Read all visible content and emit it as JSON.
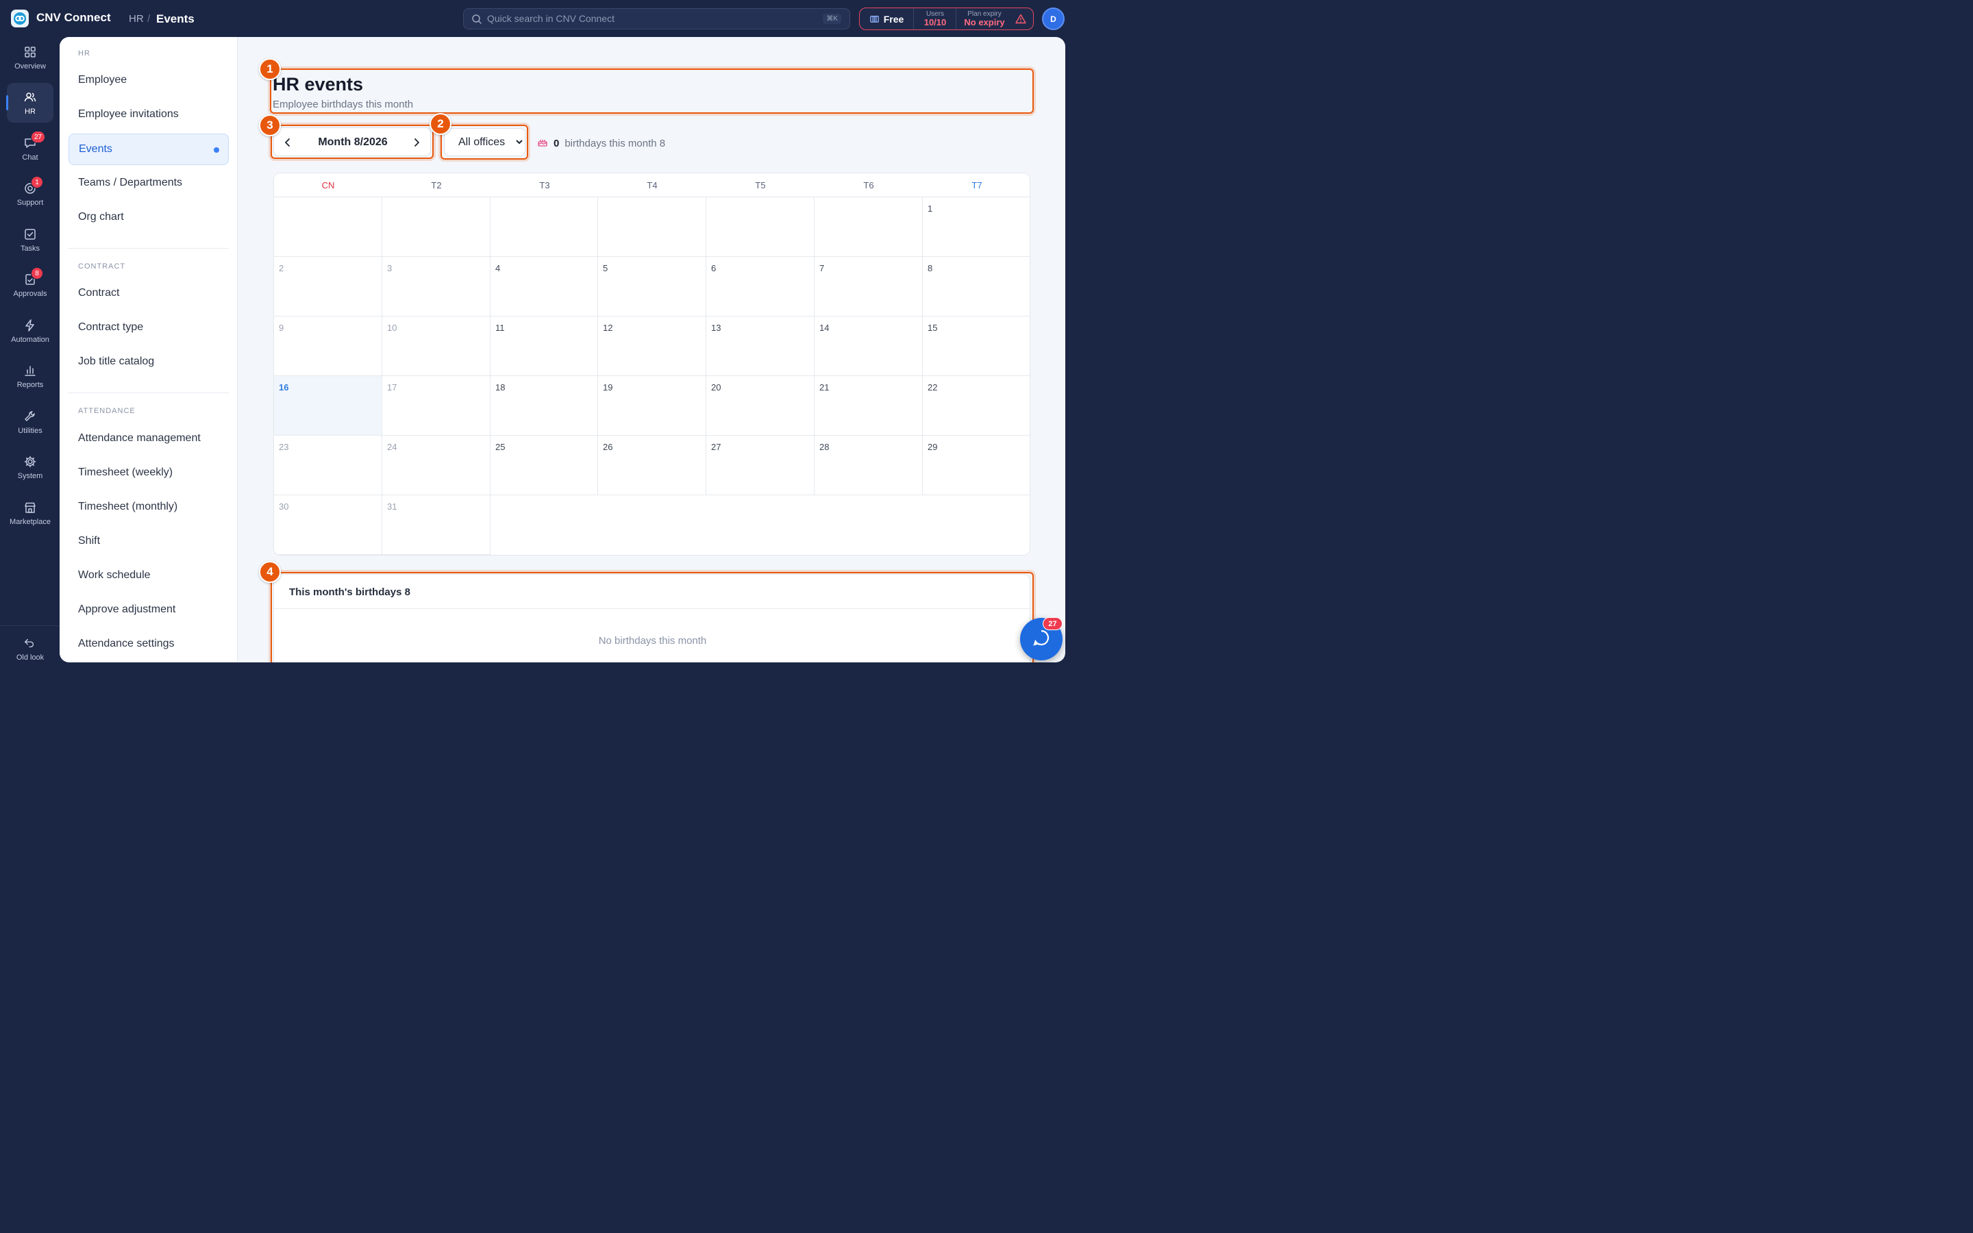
{
  "app": {
    "name": "CNV Connect",
    "breadcrumb_root": "HR",
    "breadcrumb_sep": "/",
    "breadcrumb_current": "Events"
  },
  "search": {
    "placeholder": "Quick search in CNV Connect",
    "shortcut": "⌘K"
  },
  "plan": {
    "name": "Free",
    "users_label": "Users",
    "users_value": "10/10",
    "expiry_label": "Plan expiry",
    "expiry_value": "No expiry",
    "accent": "#e5485f"
  },
  "user": {
    "initial": "D"
  },
  "rail": [
    {
      "label": "Overview",
      "icon": "grid-icon",
      "badge": ""
    },
    {
      "label": "HR",
      "icon": "users-icon",
      "badge": "",
      "active": true
    },
    {
      "label": "Chat",
      "icon": "chat-icon",
      "badge": "27"
    },
    {
      "label": "Support",
      "icon": "support-icon",
      "badge": "1"
    },
    {
      "label": "Tasks",
      "icon": "checkbox-icon",
      "badge": ""
    },
    {
      "label": "Approvals",
      "icon": "approval-icon",
      "badge": "8"
    },
    {
      "label": "Automation",
      "icon": "bolt-icon",
      "badge": ""
    },
    {
      "label": "Reports",
      "icon": "bar-chart-icon",
      "badge": ""
    },
    {
      "label": "Utilities",
      "icon": "wrench-icon",
      "badge": ""
    },
    {
      "label": "System",
      "icon": "gear-icon",
      "badge": ""
    },
    {
      "label": "Marketplace",
      "icon": "store-icon",
      "badge": ""
    }
  ],
  "rail_bottom": {
    "label": "Old look",
    "icon": "undo-icon"
  },
  "subnav": {
    "sections": [
      {
        "title": "HR",
        "items": [
          "Employee",
          "Employee invitations",
          "Events",
          "Teams / Departments",
          "Org chart"
        ]
      },
      {
        "title": "CONTRACT",
        "items": [
          "Contract",
          "Contract type",
          "Job title catalog"
        ]
      },
      {
        "title": "ATTENDANCE",
        "items": [
          "Attendance management",
          "Timesheet (weekly)",
          "Timesheet (monthly)",
          "Shift",
          "Work schedule",
          "Approve adjustment",
          "Attendance settings"
        ]
      }
    ],
    "active_item": "Events"
  },
  "page": {
    "title": "HR events",
    "subtitle": "Employee birthdays this month"
  },
  "filters": {
    "month_label": "Month 8/2026",
    "office_selected": "All offices",
    "office_options": [
      "All offices"
    ],
    "birthday_count": "0",
    "birthday_text": "birthdays this month 8"
  },
  "markers": [
    "1",
    "2",
    "3",
    "4"
  ],
  "calendar": {
    "weekdays": [
      "CN",
      "T2",
      "T3",
      "T4",
      "T5",
      "T6",
      "T7"
    ],
    "today": "16",
    "weeks": [
      [
        "",
        "",
        "",
        "",
        "",
        "",
        "1"
      ],
      [
        "2",
        "3",
        "4",
        "5",
        "6",
        "7",
        "8"
      ],
      [
        "9",
        "10",
        "11",
        "12",
        "13",
        "14",
        "15"
      ],
      [
        "16",
        "17",
        "18",
        "19",
        "20",
        "21",
        "22"
      ],
      [
        "23",
        "24",
        "25",
        "26",
        "27",
        "28",
        "29"
      ],
      [
        "30",
        "31",
        "",
        "",
        "",
        "",
        ""
      ]
    ]
  },
  "birthdays_panel": {
    "title": "This month's birthdays 8",
    "empty": "No birthdays this month"
  },
  "chat_fab": {
    "badge": "27"
  },
  "colors": {
    "topbar": "#1b2645",
    "highlight": "#e8580c",
    "primary": "#1e6be0",
    "badge": "#ef3b4f"
  }
}
